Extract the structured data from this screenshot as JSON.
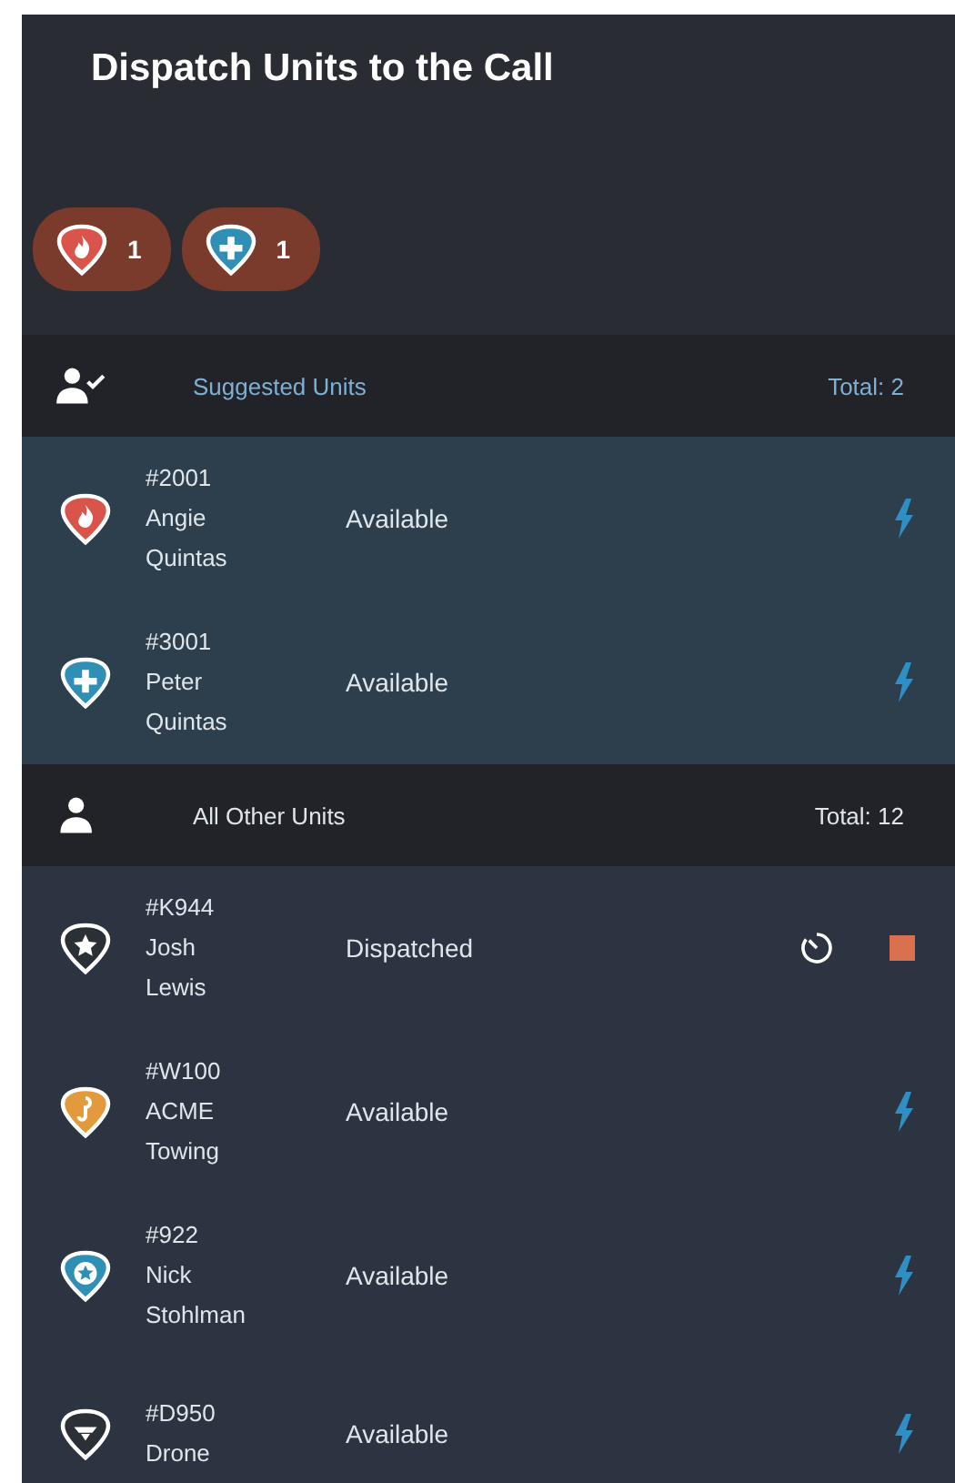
{
  "title": "Dispatch Units to the Call",
  "chips": [
    {
      "kind": "fire",
      "color": "#d9544a",
      "count": "1"
    },
    {
      "kind": "medical",
      "color": "#2f8fb5",
      "count": "1"
    }
  ],
  "sections": [
    {
      "kind": "suggested",
      "label": "Suggested Units",
      "total": "Total: 2",
      "units": [
        {
          "kind": "fire",
          "color": "#d9544a",
          "id": "#2001",
          "name": "Angie Quintas",
          "status": "Available",
          "action": {
            "kind": "dispatch"
          }
        },
        {
          "kind": "medical",
          "color": "#2f8fb5",
          "id": "#3001",
          "name": "Peter Quintas",
          "status": "Available",
          "action": {
            "kind": "dispatch"
          }
        }
      ]
    },
    {
      "kind": "other",
      "label": "All Other Units",
      "total": "Total: 12",
      "units": [
        {
          "kind": "police",
          "color": "#2b2f36",
          "id": "#K944",
          "name": "Josh Lewis",
          "status": "Dispatched",
          "action": {
            "kind": "stop"
          }
        },
        {
          "kind": "tow",
          "color": "#e39a3c",
          "id": "#W100",
          "name": "ACME Towing",
          "status": "Available",
          "action": {
            "kind": "dispatch"
          }
        },
        {
          "kind": "star",
          "color": "#2f8fb5",
          "id": "#922",
          "name": "Nick Stohlman",
          "status": "Available",
          "action": {
            "kind": "dispatch"
          }
        },
        {
          "kind": "drone",
          "color": "#2b2f36",
          "id": "#D950",
          "name": "Drone",
          "status": "Available",
          "action": {
            "kind": "dispatch"
          }
        }
      ]
    }
  ]
}
